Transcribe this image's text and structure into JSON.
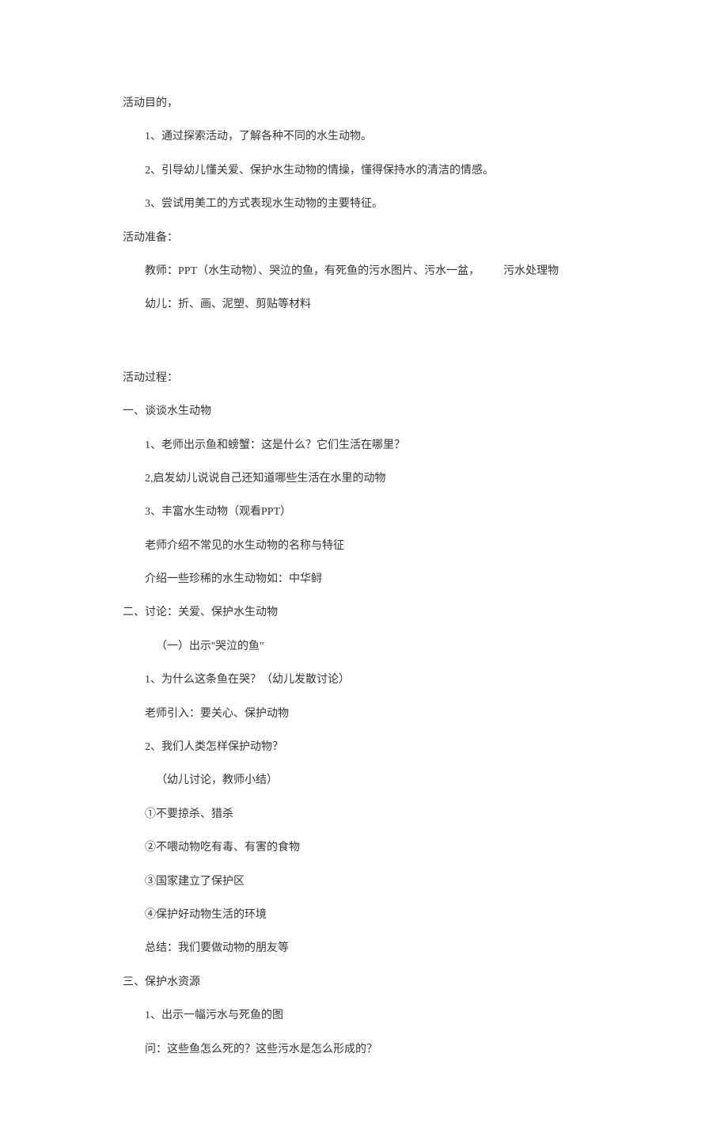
{
  "sections": {
    "purpose": {
      "title": "活动目的，",
      "items": [
        "1、通过探索活动，了解各种不同的水生动物。",
        "2、引导幼儿懂关爱、保护水生动物的情操，懂得保持水的清洁的情感。",
        "3、尝试用美工的方式表现水生动物的主要特征。"
      ]
    },
    "preparation": {
      "title": "活动准备：",
      "teacher_label": "教师：",
      "teacher_content": "PPT（水生动物）、哭泣的鱼，有死鱼的污水图片、污水一盆，",
      "teacher_extra": "污水处理物",
      "children": "幼儿：折、画、泥塑、剪贴等材料"
    },
    "process": {
      "title": "活动过程：",
      "section1": {
        "title": "一、谈谈水生动物",
        "items": [
          "1、老师出示鱼和螃蟹：这是什么？它们生活在哪里？",
          "2,启发幼儿说说自己还知道哪些生活在水里的动物",
          "3、丰富水生动物（观看PPT）",
          "老师介绍不常见的水生动物的名称与特征",
          "介绍一些珍稀的水生动物如：中华鲟"
        ]
      },
      "section2": {
        "title": "二、讨论：关爱、保护水生动物",
        "sub1": "（一）出示''哭泣的鱼\"",
        "items": [
          "1、为什么这条鱼在哭？（幼儿发散讨论）",
          "老师引入：要关心、保护动物",
          "2、我们人类怎样保护动物？"
        ],
        "discuss": "（幼儿讨论，教师小结）",
        "points": [
          "①不要掠杀、猎杀",
          "②不喂动物吃有毒、有害的食物",
          "③国家建立了保护区",
          "④保护好动物生活的环境",
          "总结：我们要做动物的朋友等"
        ]
      },
      "section3": {
        "title": "三、保护水资源",
        "items": [
          "1、出示一幅污水与死鱼的图",
          "问：这些鱼怎么死的？这些污水是怎么形成的？"
        ]
      }
    }
  }
}
